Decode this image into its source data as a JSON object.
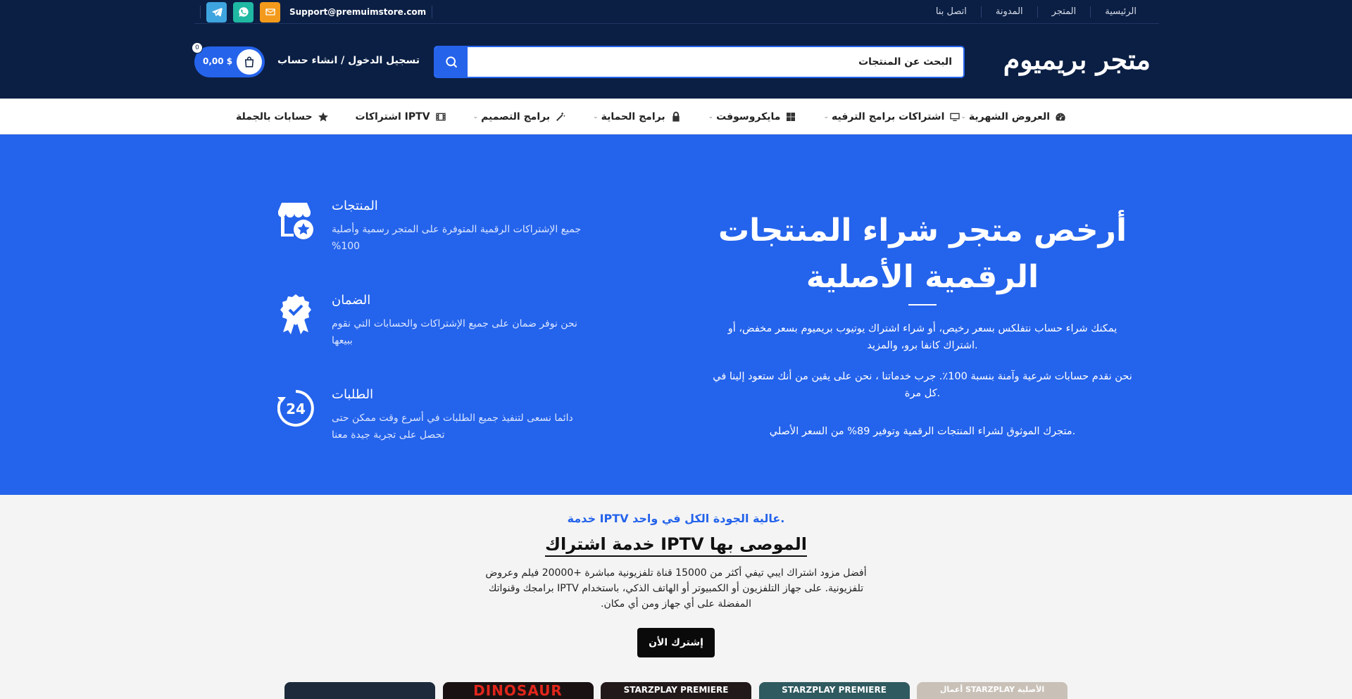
{
  "topbar": {
    "nav": [
      "الرئيسية",
      "المتجر",
      "المدونة",
      "اتصل بنا"
    ],
    "support_email": "Support@premuimstore.com"
  },
  "header": {
    "logo": "متجر بريميوم",
    "search_placeholder": "البحث عن المنتجات",
    "login_label": "تسجيل الدخول / انشاء حساب",
    "cart_total": "0,00 $",
    "cart_count": "0"
  },
  "categories": [
    {
      "label": "العروض الشهرية",
      "icon": "gauge-icon",
      "dropdown": true
    },
    {
      "label": "اشتراكات برامج الترفيه",
      "icon": "monitor-icon",
      "dropdown": true
    },
    {
      "label": "مايكروسوفت",
      "icon": "windows-icon",
      "dropdown": true
    },
    {
      "label": "برامج الحماية",
      "icon": "lock-icon",
      "dropdown": true
    },
    {
      "label": "برامج التصميم",
      "icon": "magic-wand-icon",
      "dropdown": true
    },
    {
      "label": "اشتراكات IPTV",
      "icon": "film-icon",
      "dropdown": false
    },
    {
      "label": "حسابات بالجملة",
      "icon": "star-icon",
      "dropdown": false
    }
  ],
  "hero": {
    "title_line1": "أرخص متجر شراء المنتجات",
    "title_line2": "الرقمية الأصلية",
    "p1": "يمكنك شراء حساب نتفلكس بسعر رخيص، أو شراء اشتراك يوتيوب بريميوم بسعر مخفض، أو اشتراك كانفا برو، والمزيد.",
    "p2": "نحن نقدم حسابات شرعية وآمنة بنسبة 100٪. جرب خدماتنا ، نحن على يقين من أنك ستعود إلينا في كل مرة.",
    "p3": "متجرك الموثوق لشراء المنتجات الرقمية وتوفير 89% من السعر الأصلي.",
    "features": [
      {
        "title": "المنتجات",
        "desc": "جميع الإشتراكات الرقمية المتوفرة على المتجر رسمية وأصلية 100%",
        "icon": "store-star-icon"
      },
      {
        "title": "الضمان",
        "desc": "نحن نوفر ضمان على جميع الإشتراكات والحسابات التي نقوم ببيعها",
        "icon": "badge-check-icon"
      },
      {
        "title": "الطلبات",
        "desc": "دائما نسعى لتنفيذ جميع الطلبات في أسرع وقت ممكن حتى تحصل على تجربة جيدة معنا",
        "icon": "clock-24-icon",
        "icon_text": "24"
      }
    ]
  },
  "iptv": {
    "subtitle": "خدمة IPTV عالية الجودة الكل في واحد.",
    "title": "خدمة اشتراك IPTV الموصى بها",
    "desc": "أفضل مزود اشتراك ايبي تيفي أكثر من 15000 قناة تلفزيونية مباشرة +20000 فيلم وعروض تلفزيونية. على جهاز التلفزيون أو الكمبيوتر أو الهاتف الذكي، باستخدام IPTV برامجك وقنواتك المفضلة على أي جهاز ومن أي مكان.",
    "cta": "إشترك الأن",
    "posters": [
      "أعمال STARZPLAY الأصلية",
      "STARZPLAY PREMIERE",
      "STARZPLAY PREMIERE",
      "DINOSAUR",
      ""
    ]
  }
}
